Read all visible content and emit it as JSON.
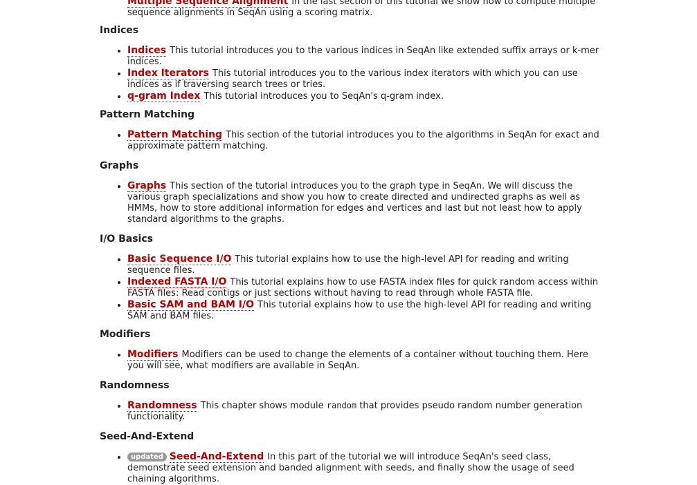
{
  "top_fragment": {
    "link": "Multiple Sequence Alignment",
    "desc_line1": "In the last section of this tutorial we show how to compute multiple",
    "desc_line2": "sequence alignments in SeqAn using a scoring matrix."
  },
  "sections": [
    {
      "heading": "Indices",
      "items": [
        {
          "link": "Indices",
          "desc": "This tutorial introduces you to the various indices in SeqAn like extended suffix arrays or k-mer indices."
        },
        {
          "link": "Index Iterators",
          "desc": "This tutorial introduces you to the various index iterators with which you can use indices as if traversing search trees or tries."
        },
        {
          "link": "q-gram Index",
          "desc": "This tutorial introduces you to SeqAn's q-gram index."
        }
      ]
    },
    {
      "heading": "Pattern Matching",
      "items": [
        {
          "link": "Pattern Matching",
          "desc": "This section of the tutorial introduces you to the algorithms in SeqAn for exact and approximate pattern matching."
        }
      ]
    },
    {
      "heading": "Graphs",
      "items": [
        {
          "link": "Graphs",
          "desc": "This section of the tutorial introduces you to the graph type in SeqAn. We will discuss the various graph specializations and show you how to create directed and undirected graphs as well as HMMs, how to store additional information for edges and vertices and last but not least how to apply standard algorithms to the graphs."
        }
      ]
    },
    {
      "heading": "I/O Basics",
      "items": [
        {
          "link": "Basic Sequence I/O",
          "desc": "This tutorial explains how to use the high-level API for reading and writing sequence files."
        },
        {
          "link": "Indexed FASTA I/O",
          "desc": "This tutorial explains how to use FASTA index files for quick random access within FASTA files: Read contigs or just sections without having to read through whole FASTA file."
        },
        {
          "link": "Basic SAM and BAM I/O",
          "desc": "This tutorial explains how to use the high-level API for reading and writing SAM and BAM files."
        }
      ]
    },
    {
      "heading": "Modifiers",
      "items": [
        {
          "link": "Modifiers",
          "desc": "Modifiers can be used to change the elements of a container without touching them. Here you will see, what modifiers are available in SeqAn."
        }
      ]
    },
    {
      "heading": "Randomness",
      "items": [
        {
          "link": "Randomness",
          "desc_before": "This chapter shows module",
          "code": "random",
          "desc_after": "that provides pseudo random number generation functionality."
        }
      ]
    },
    {
      "heading": "Seed-And-Extend",
      "items": [
        {
          "badge": "updated",
          "link": "Seed-And-Extend",
          "desc": "In this part of the tutorial we will introduce SeqAn's seed class, demonstrate seed extension and banded alignment with seeds, and finally show the usage of seed chaining algorithms."
        }
      ]
    }
  ],
  "colors": {
    "link": "#bb0000",
    "text": "#222222",
    "badge_bg": "#999999",
    "background": "#ffffff"
  }
}
